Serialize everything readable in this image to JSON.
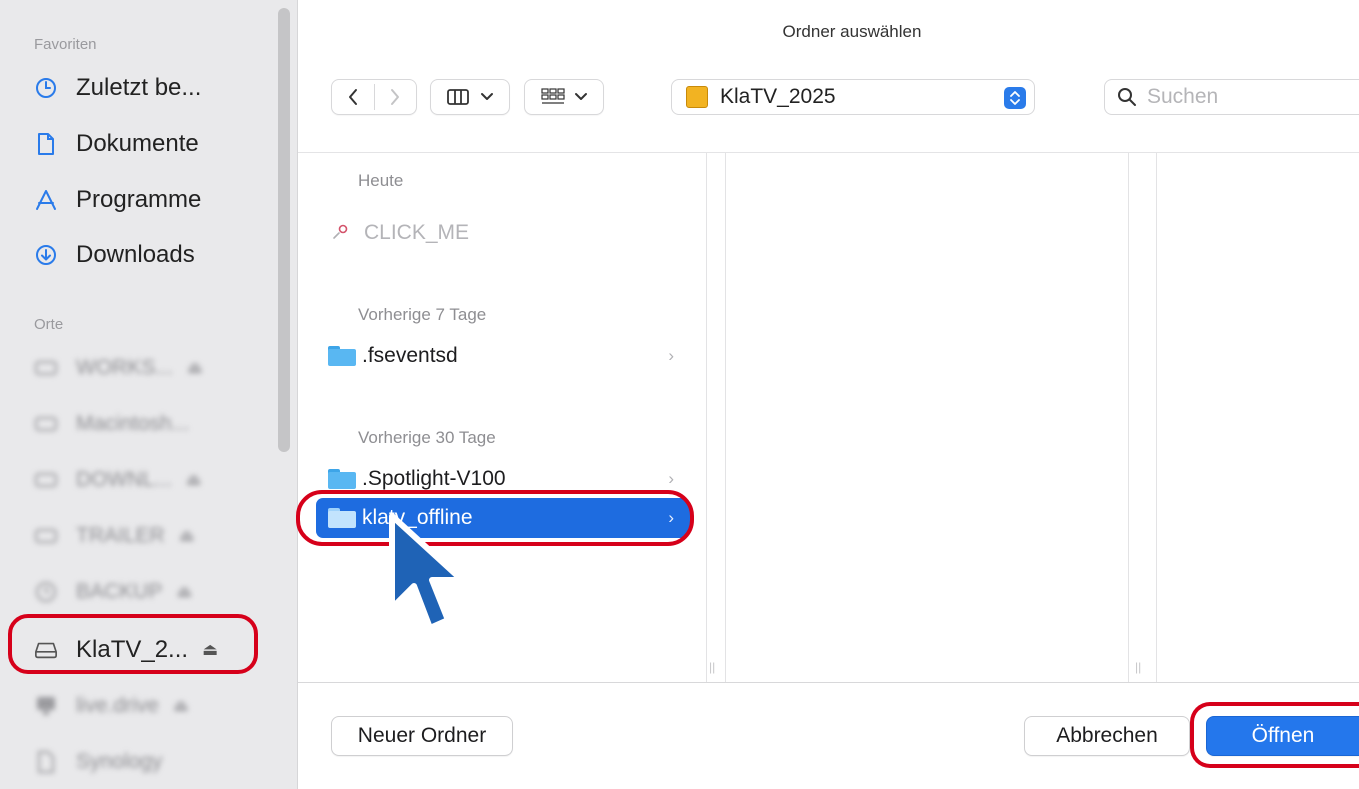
{
  "window": {
    "title": "Ordner auswählen"
  },
  "sidebar": {
    "favorites_header": "Favoriten",
    "favorites": [
      {
        "label": "Zuletzt be...",
        "icon": "clock-icon"
      },
      {
        "label": "Dokumente",
        "icon": "document-icon"
      },
      {
        "label": "Programme",
        "icon": "applications-icon"
      },
      {
        "label": "Downloads",
        "icon": "download-icon"
      }
    ],
    "places_header": "Orte",
    "places": [
      {
        "label": "WORKS...",
        "icon": "drive-icon"
      },
      {
        "label": "Macintosh...",
        "icon": "drive-icon"
      },
      {
        "label": "DOWNL...",
        "icon": "drive-icon"
      },
      {
        "label": "TRAILER",
        "icon": "drive-icon"
      },
      {
        "label": "BACKUP",
        "icon": "time-machine-icon"
      },
      {
        "label": "KlaTV_2...",
        "icon": "external-drive-icon",
        "eject": "⏏"
      },
      {
        "label": "live.drive",
        "icon": "network-drive-icon"
      },
      {
        "label": "Synology",
        "icon": "document-icon"
      }
    ]
  },
  "toolbar": {
    "view_mode": "columns",
    "path_label": "KlaTV_2025",
    "search_placeholder": "Suchen"
  },
  "browser": {
    "groups": [
      {
        "header": "Heute",
        "items": [
          {
            "name": "CLICK_ME",
            "kind": "app",
            "disabled": true
          }
        ]
      },
      {
        "header": "Vorherige 7 Tage",
        "items": [
          {
            "name": ".fseventsd",
            "kind": "folder"
          }
        ]
      },
      {
        "header": "Vorherige 30 Tage",
        "items": [
          {
            "name": ".Spotlight-V100",
            "kind": "folder"
          },
          {
            "name": "klatv_offline",
            "kind": "folder",
            "selected": true
          }
        ]
      }
    ]
  },
  "buttons": {
    "new_folder": "Neuer Ordner",
    "cancel": "Abbrechen",
    "open": "Öffnen"
  },
  "colors": {
    "accent": "#2477ec",
    "selection": "#1e6ce0",
    "highlight_ring": "#d6001a",
    "sidebar_bg": "#e9e9eb"
  }
}
